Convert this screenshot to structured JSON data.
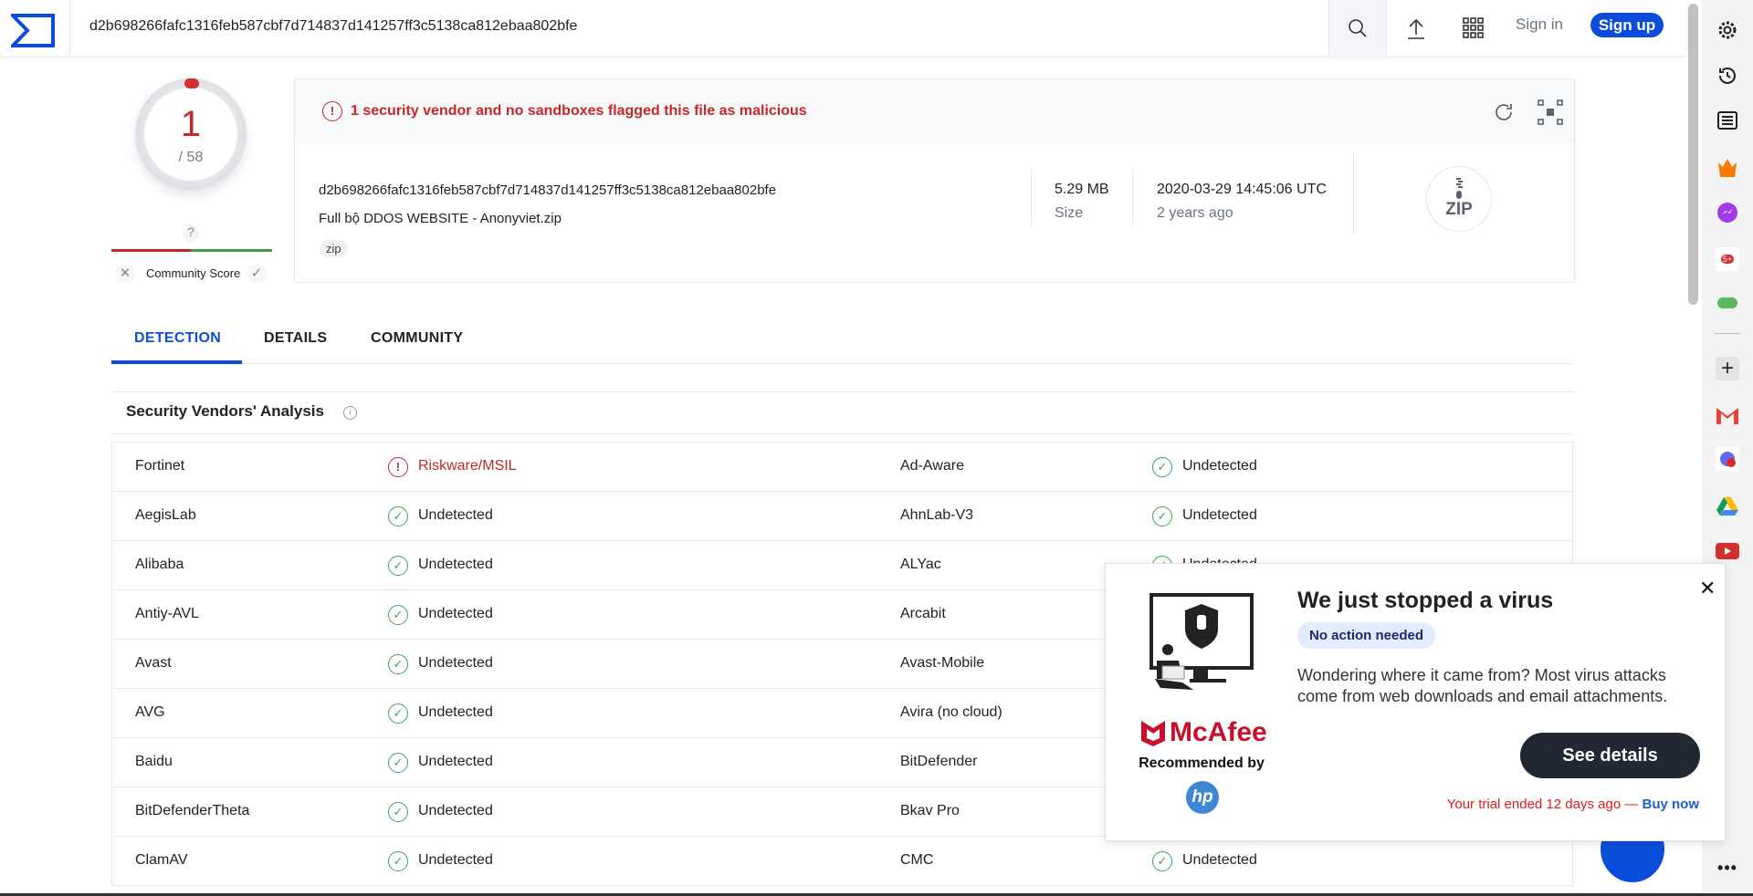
{
  "header": {
    "hash": "d2b698266fafc1316feb587cbf7d714837d141257ff3c5138ca812ebaa802bfe",
    "sign_in": "Sign in",
    "sign_up": "Sign up",
    "icons": [
      "search-icon",
      "upload-icon",
      "apps-grid-icon"
    ]
  },
  "score": {
    "detections": "1",
    "total": "/ 58",
    "community_unknown": "?",
    "community_label": "Community Score",
    "colors": {
      "malicious": "#c62828",
      "harmless": "#43a047"
    }
  },
  "file": {
    "alert": "1 security vendor and no sandboxes flagged this file as malicious",
    "hash": "d2b698266fafc1316feb587cbf7d714837d141257ff3c5138ca812ebaa802bfe",
    "name": "Full bộ DDOS WEBSITE - Anonyviet.zip",
    "tag": "zip",
    "size": "5.29 MB",
    "size_label": "Size",
    "date": "2020-03-29 14:45:06 UTC",
    "date_relative": "2 years ago",
    "type_icon": "ZIP"
  },
  "tabs": [
    {
      "label": "DETECTION",
      "active": true
    },
    {
      "label": "DETAILS"
    },
    {
      "label": "COMMUNITY"
    }
  ],
  "section": {
    "title": "Security Vendors' Analysis"
  },
  "vendors": [
    {
      "left": "Fortinet",
      "left_result": "Riskware/MSIL",
      "left_status": "malicious",
      "right": "Ad-Aware",
      "right_result": "Undetected"
    },
    {
      "left": "AegisLab",
      "left_result": "Undetected",
      "left_status": "ok",
      "right": "AhnLab-V3",
      "right_result": "Undetected"
    },
    {
      "left": "Alibaba",
      "left_result": "Undetected",
      "left_status": "ok",
      "right": "ALYac",
      "right_result": "Undetected"
    },
    {
      "left": "Antiy-AVL",
      "left_result": "Undetected",
      "left_status": "ok",
      "right": "Arcabit"
    },
    {
      "left": "Avast",
      "left_result": "Undetected",
      "left_status": "ok",
      "right": "Avast-Mobile"
    },
    {
      "left": "AVG",
      "left_result": "Undetected",
      "left_status": "ok",
      "right": "Avira (no cloud)"
    },
    {
      "left": "Baidu",
      "left_result": "Undetected",
      "left_status": "ok",
      "right": "BitDefender"
    },
    {
      "left": "BitDefenderTheta",
      "left_result": "Undetected",
      "left_status": "ok",
      "right": "Bkav Pro"
    },
    {
      "left": "ClamAV",
      "left_result": "Undetected",
      "left_status": "ok",
      "right": "CMC",
      "right_result": "Undetected"
    }
  ],
  "popup": {
    "title": "We just stopped a virus",
    "badge": "No action needed",
    "body": "Wondering where it came from? Most virus attacks come from web downloads and email attachments.",
    "button": "See details",
    "trial": "Your trial ended 12 days ago — ",
    "buy": "Buy now",
    "brand": "McAfee",
    "recommended": "Recommended by",
    "partner": "hp"
  },
  "browser_sidebar": [
    "gear-icon",
    "history-icon",
    "reading-list-icon",
    "crown-icon",
    "messenger-icon",
    "notification-icon",
    "games-icon",
    "add-icon",
    "gmail-icon",
    "calendar-icon",
    "drive-icon",
    "youtube-icon",
    "more-icon"
  ]
}
